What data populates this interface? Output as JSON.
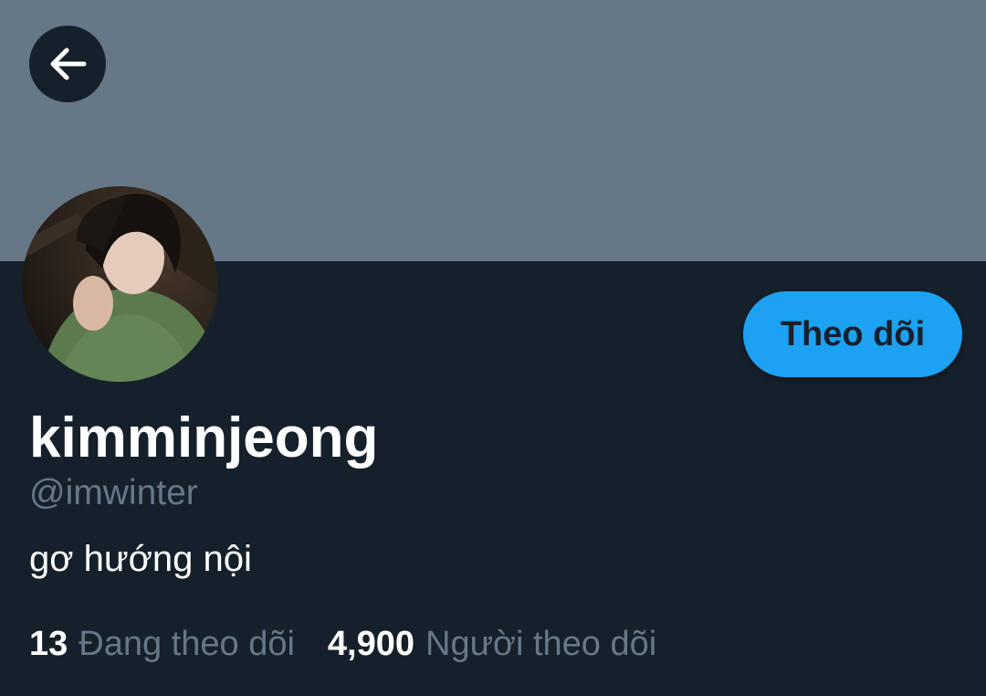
{
  "header": {
    "back_icon": "arrow-left-icon",
    "banner_color": "#667788"
  },
  "profile": {
    "display_name": "kimminjeong",
    "handle": "@imwinter",
    "bio": "gơ hướng nội",
    "follow_label": "Theo dõi",
    "avatar_icon": "profile-photo"
  },
  "stats": {
    "following_count": "13",
    "following_label": "Đang theo dõi",
    "followers_count": "4,900",
    "followers_label": "Người theo dõi"
  },
  "colors": {
    "background": "#16202b",
    "accent": "#1da1f2",
    "muted_text": "#667788",
    "text": "#ffffff"
  }
}
